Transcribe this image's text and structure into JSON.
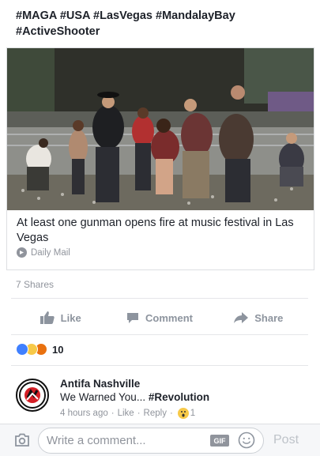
{
  "post": {
    "hashtags": "#MAGA #USA #LasVegas #MandalayBay #ActiveShooter"
  },
  "link_card": {
    "title": "At least one gunman opens fire at music festival in Las Vegas",
    "source": "Daily Mail",
    "image_icon": "news-photo"
  },
  "stats": {
    "shares": "7 Shares",
    "reaction_count": "10",
    "reaction_icons": [
      "like-icon",
      "sad-icon",
      "angry-icon"
    ]
  },
  "actions": {
    "like": "Like",
    "comment": "Comment",
    "share": "Share"
  },
  "comment": {
    "author": "Antifa Nashville",
    "text": "We Warned You... ",
    "hashtag": "#Revolution",
    "time": "4 hours ago",
    "like": "Like",
    "reply": "Reply",
    "reaction_count": "1"
  },
  "composer": {
    "placeholder": "Write a comment...",
    "gif": "GIF",
    "post": "Post"
  },
  "colors": {
    "text": "#1d2129",
    "muted": "#90949c",
    "divider": "#e5e6e9",
    "like_blue": "#4080ff"
  }
}
